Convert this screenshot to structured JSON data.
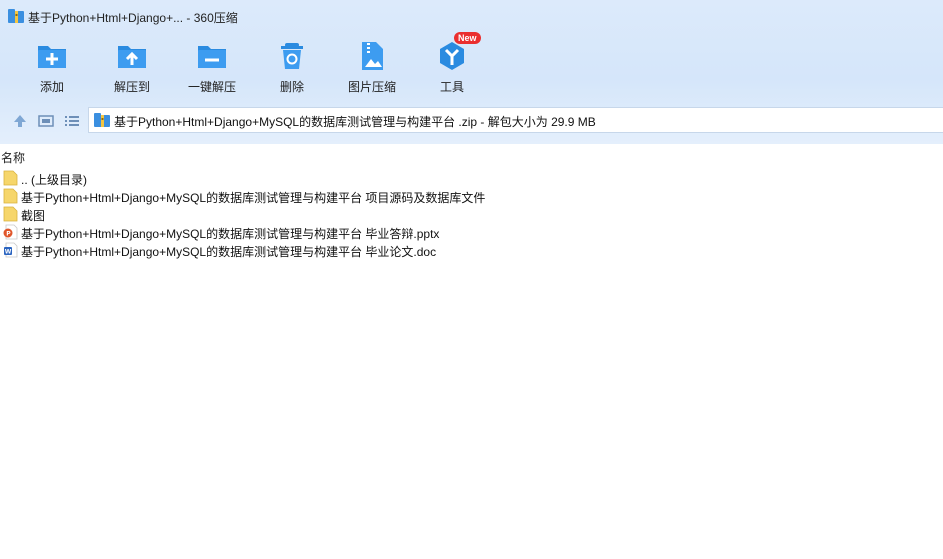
{
  "window": {
    "title": "基于Python+Html+Django+... - 360压缩"
  },
  "toolbar": {
    "items": [
      {
        "label": "添加",
        "icon": "add-icon"
      },
      {
        "label": "解压到",
        "icon": "extract-to-icon"
      },
      {
        "label": "一键解压",
        "icon": "one-click-extract-icon"
      },
      {
        "label": "删除",
        "icon": "delete-icon"
      },
      {
        "label": "图片压缩",
        "icon": "image-compress-icon"
      },
      {
        "label": "工具",
        "icon": "tools-icon",
        "badge": "New"
      }
    ]
  },
  "nav": {
    "path": "基于Python+Html+Django+MySQL的数据库测试管理与构建平台 .zip - 解包大小为 29.9 MB"
  },
  "list": {
    "column_name": "名称",
    "rows": [
      {
        "name": ".. (上级目录)",
        "type": "folder"
      },
      {
        "name": "基于Python+Html+Django+MySQL的数据库测试管理与构建平台 项目源码及数据库文件",
        "type": "folder"
      },
      {
        "name": "截图",
        "type": "folder"
      },
      {
        "name": "基于Python+Html+Django+MySQL的数据库测试管理与构建平台 毕业答辩.pptx",
        "type": "pptx"
      },
      {
        "name": "基于Python+Html+Django+MySQL的数据库测试管理与构建平台 毕业论文.doc",
        "type": "doc"
      }
    ]
  },
  "colors": {
    "accent": "#2a8be0",
    "toolbar_bg": "#d8e8fb",
    "badge": "#ea2f2f",
    "folder": "#f6d66b"
  }
}
